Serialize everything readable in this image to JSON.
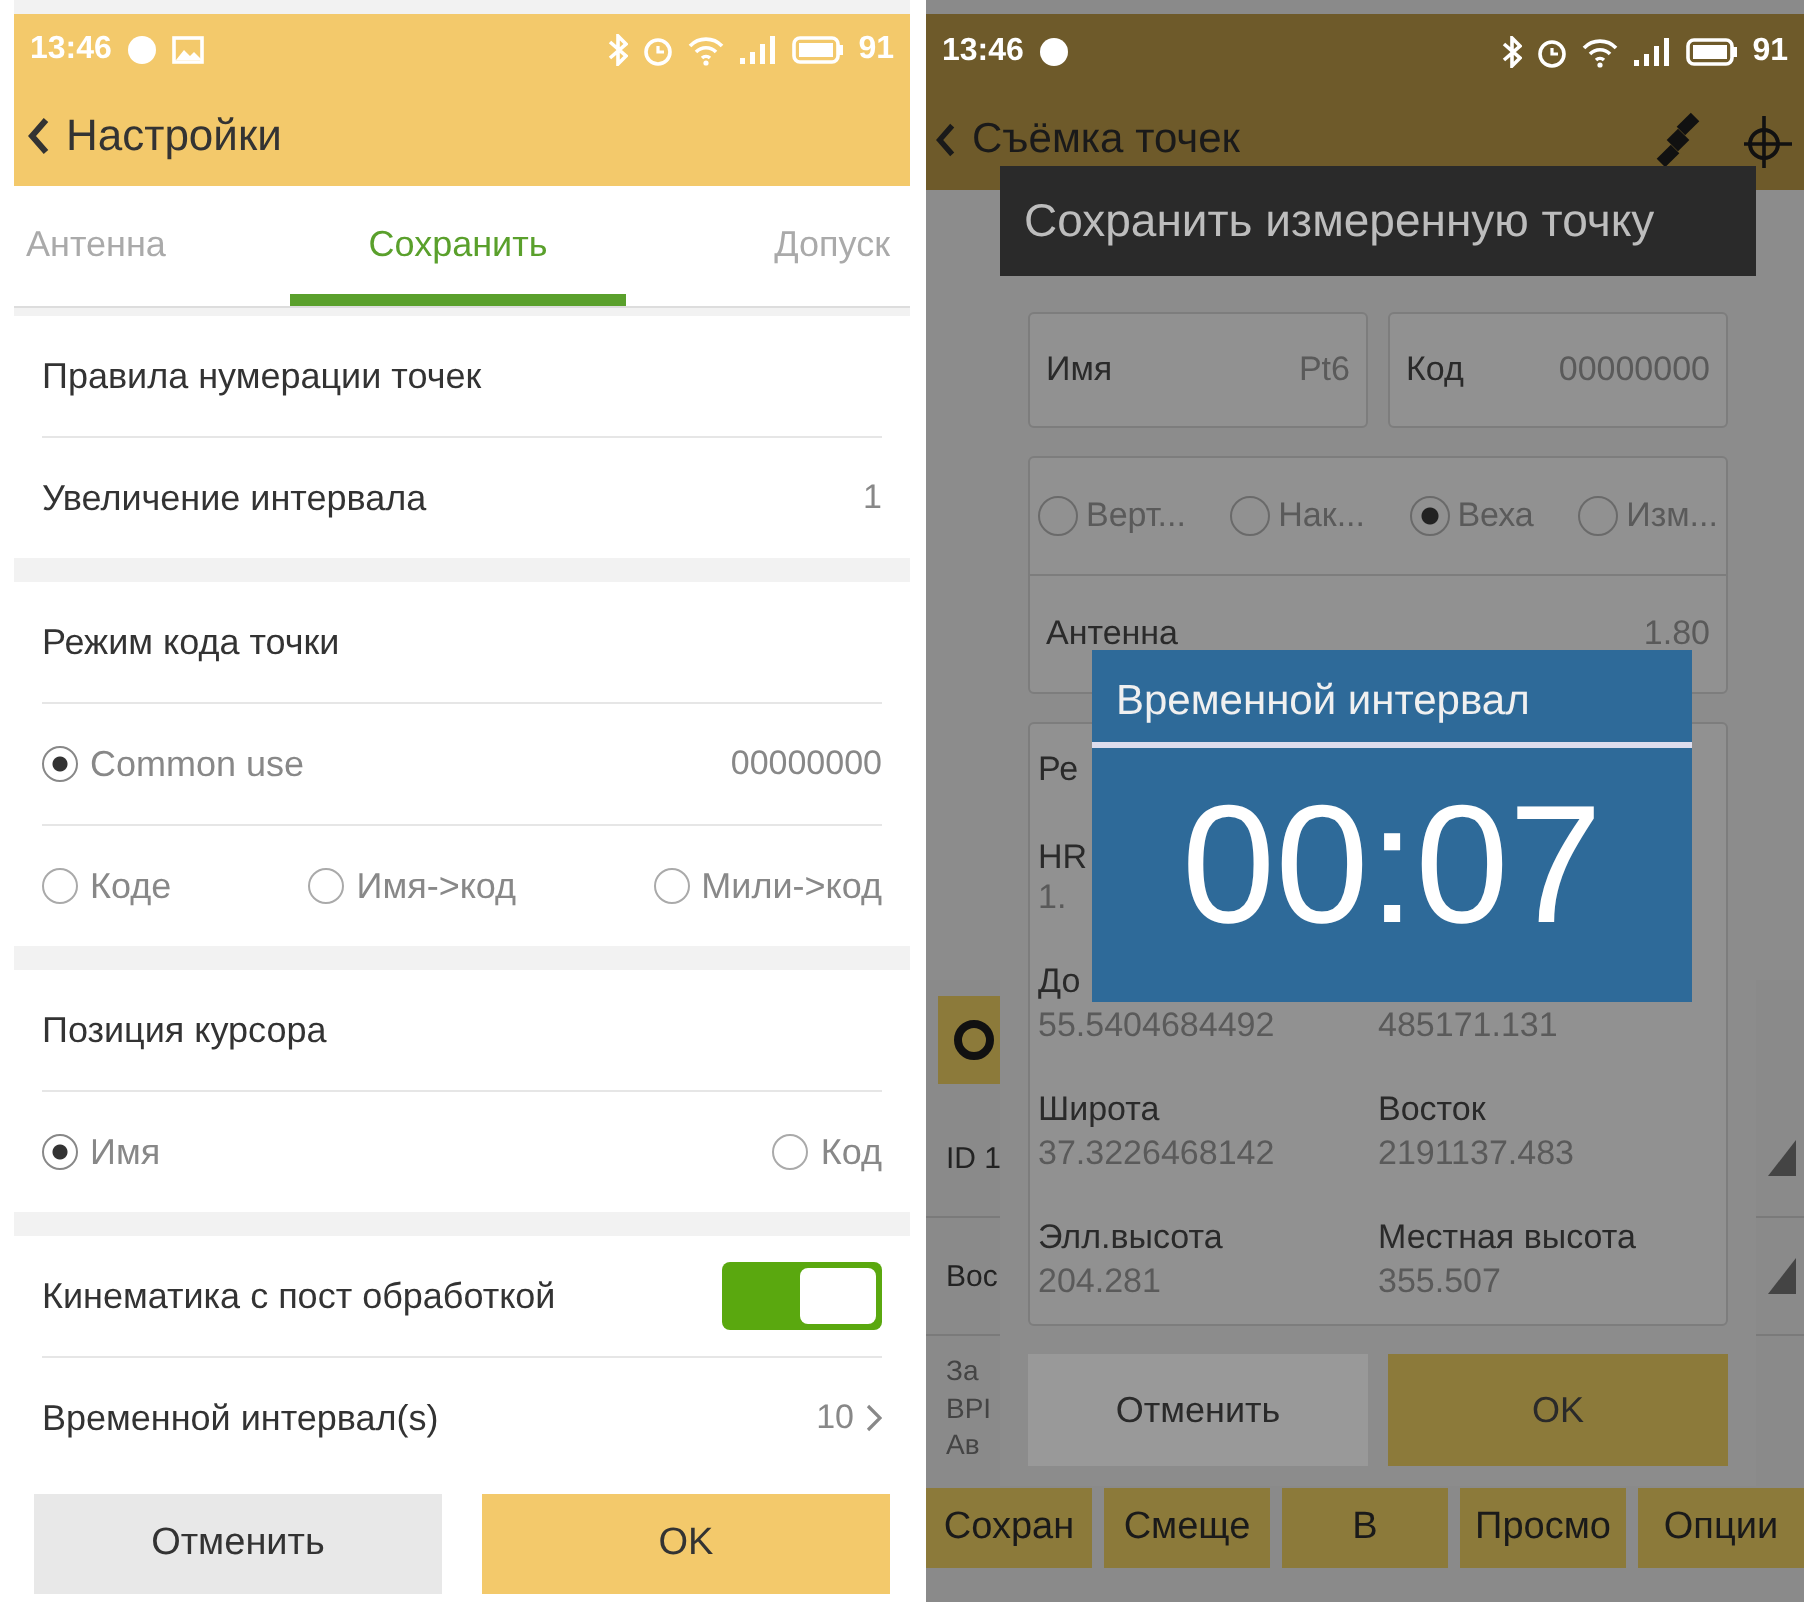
{
  "left": {
    "status_bar": {
      "time": "13:46",
      "battery": "91"
    },
    "header": {
      "title": "Настройки"
    },
    "tabs": [
      {
        "label": "Антенна",
        "selected": false
      },
      {
        "label": "Сохранить",
        "selected": true
      },
      {
        "label": "Допуск",
        "selected": false
      }
    ],
    "sections": [
      {
        "rows": [
          {
            "kind": "heading",
            "label": "Правила нумерации точек"
          },
          {
            "kind": "value",
            "label": "Увеличение интервала",
            "value": "1"
          }
        ]
      },
      {
        "rows": [
          {
            "kind": "heading",
            "label": "Режим кода точки"
          },
          {
            "kind": "radios",
            "options": [
              {
                "label": "Common use",
                "selected": true
              }
            ],
            "value": "00000000"
          },
          {
            "kind": "radios",
            "options": [
              {
                "label": "Коде",
                "selected": false
              },
              {
                "label": "Имя->код",
                "selected": false
              },
              {
                "label": "Мили->код",
                "selected": false
              }
            ]
          }
        ]
      },
      {
        "rows": [
          {
            "kind": "heading",
            "label": "Позиция курсора"
          },
          {
            "kind": "radios",
            "options": [
              {
                "label": "Имя",
                "selected": true
              },
              {
                "label": "Код",
                "selected": false
              }
            ]
          }
        ]
      },
      {
        "rows": [
          {
            "kind": "toggle",
            "label": "Кинематика с пост обработкой",
            "on": true
          },
          {
            "kind": "link",
            "label": "Временной интервал(s)",
            "value": "10"
          }
        ]
      }
    ],
    "buttons": [
      "Отменить",
      "OK"
    ]
  },
  "right": {
    "status_bar": {
      "time": "13:46",
      "battery": "91"
    },
    "header": {
      "title": "Съёмка точек"
    },
    "background_rows": [
      "ID 1",
      "Вос"
    ],
    "background_notes": [
      "За",
      "BPI",
      "Ав"
    ],
    "toolbar": [
      "Сохран",
      "Смеще",
      "В",
      "Просмо",
      "Опции"
    ],
    "dialog": {
      "title": "Сохранить измеренную точку",
      "fields": [
        {
          "label": "Имя",
          "value": "Pt6"
        },
        {
          "label": "Код",
          "value": "00000000"
        }
      ],
      "pole_options": [
        {
          "label": "Верт...",
          "selected": false
        },
        {
          "label": "Нак...",
          "selected": false
        },
        {
          "label": "Веха",
          "selected": true
        },
        {
          "label": "Изм...",
          "selected": false
        }
      ],
      "antenna": {
        "label": "Антенна",
        "value": "1.80"
      },
      "covered_fragments": [
        "Ре",
        "HR",
        "1."
      ],
      "longitude": {
        "label": "До",
        "value": "55.5404684492"
      },
      "north_value": "485171.131",
      "grid": [
        {
          "label": "Широта",
          "value": "37.3226468142"
        },
        {
          "label": "Восток",
          "value": "2191137.483"
        },
        {
          "label": "Элл.высота",
          "value": "204.281"
        },
        {
          "label": "Местная высота",
          "value": "355.507"
        }
      ],
      "buttons": [
        "Отменить",
        "OK"
      ]
    },
    "timer": {
      "title": "Временной интервал",
      "time": "00:07"
    }
  }
}
